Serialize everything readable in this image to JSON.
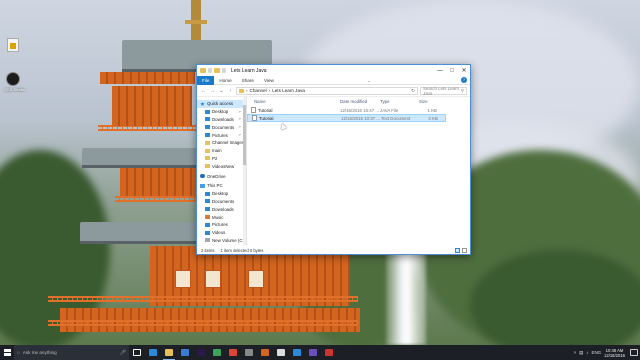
{
  "desktop": {
    "icons": [
      {
        "label": "",
        "icon": "document-icon"
      },
      {
        "label": "OBS Studio",
        "icon": "obs-icon"
      }
    ]
  },
  "explorer": {
    "title": "Lets Learn Java",
    "ribbon_tabs": [
      "File",
      "Home",
      "Share",
      "View"
    ],
    "help": "?",
    "address_path": [
      "Channel",
      "Lets Learn Java"
    ],
    "search_placeholder": "Search Lets Learn Java",
    "nav_items": [
      {
        "label": "Quick access",
        "icon": "star-icon",
        "pinned": false
      },
      {
        "label": "Desktop",
        "icon": "desktop-icon",
        "pinned": true
      },
      {
        "label": "Downloads",
        "icon": "downloads-icon",
        "pinned": true
      },
      {
        "label": "Documents",
        "icon": "documents-icon",
        "pinned": true
      },
      {
        "label": "Pictures",
        "icon": "pictures-icon",
        "pinned": true
      },
      {
        "label": "Channel Images",
        "icon": "folder-icon",
        "pinned": false
      },
      {
        "label": "main",
        "icon": "folder-icon",
        "pinned": false
      },
      {
        "label": "P2",
        "icon": "folder-icon",
        "pinned": false
      },
      {
        "label": "VideosNew",
        "icon": "folder-icon",
        "pinned": false
      },
      {
        "label": "OneDrive",
        "icon": "onedrive-icon",
        "pinned": false
      },
      {
        "label": "This PC",
        "icon": "pc-icon",
        "pinned": false
      },
      {
        "label": "Desktop",
        "icon": "desktop-icon",
        "pinned": false
      },
      {
        "label": "Documents",
        "icon": "documents-icon",
        "pinned": false
      },
      {
        "label": "Downloads",
        "icon": "downloads-icon",
        "pinned": false
      },
      {
        "label": "Music",
        "icon": "music-icon",
        "pinned": false
      },
      {
        "label": "Pictures",
        "icon": "pictures-icon",
        "pinned": false
      },
      {
        "label": "Videos",
        "icon": "videos-icon",
        "pinned": false
      },
      {
        "label": "New Volume (C:)",
        "icon": "drive-icon",
        "pinned": false
      }
    ],
    "columns": {
      "name": "Name",
      "date": "Date modified",
      "type": "Type",
      "size": "Size"
    },
    "files": [
      {
        "name": "Tutorial",
        "date": "12/16/2016 10:47 ...",
        "type": "JAVA File",
        "size": "1 KB",
        "selected": false
      },
      {
        "name": "Tutorial",
        "date": "12/16/2016 10:37 ...",
        "type": "Text Document",
        "size": "0 KB",
        "selected": true
      }
    ],
    "status": {
      "items": "2 items",
      "selection": "1 item selected  0 bytes"
    }
  },
  "taskbar": {
    "search_placeholder": "Ask me anything",
    "apps": [
      {
        "icon": "task-view-icon",
        "color": "#ffffff"
      },
      {
        "icon": "edge-icon",
        "color": "#2b89d9"
      },
      {
        "icon": "file-explorer-icon",
        "color": "#e8c156"
      },
      {
        "icon": "store-icon",
        "color": "#3a7bd5"
      },
      {
        "icon": "premiere-icon",
        "color": "#2a1a4a"
      },
      {
        "icon": "app-icon",
        "color": "#3aa55a"
      },
      {
        "icon": "chrome-icon",
        "color": "#db4437"
      },
      {
        "icon": "app-icon",
        "color": "#888888"
      },
      {
        "icon": "app-icon",
        "color": "#d4651f"
      },
      {
        "icon": "obs-icon",
        "color": "#dddddd"
      },
      {
        "icon": "app-icon",
        "color": "#2b89d9"
      },
      {
        "icon": "app-icon",
        "color": "#6a4fbf"
      },
      {
        "icon": "app-icon",
        "color": "#cc3333"
      }
    ],
    "language": "ENG",
    "time": "10:48 AM",
    "date": "12/16/2016"
  }
}
